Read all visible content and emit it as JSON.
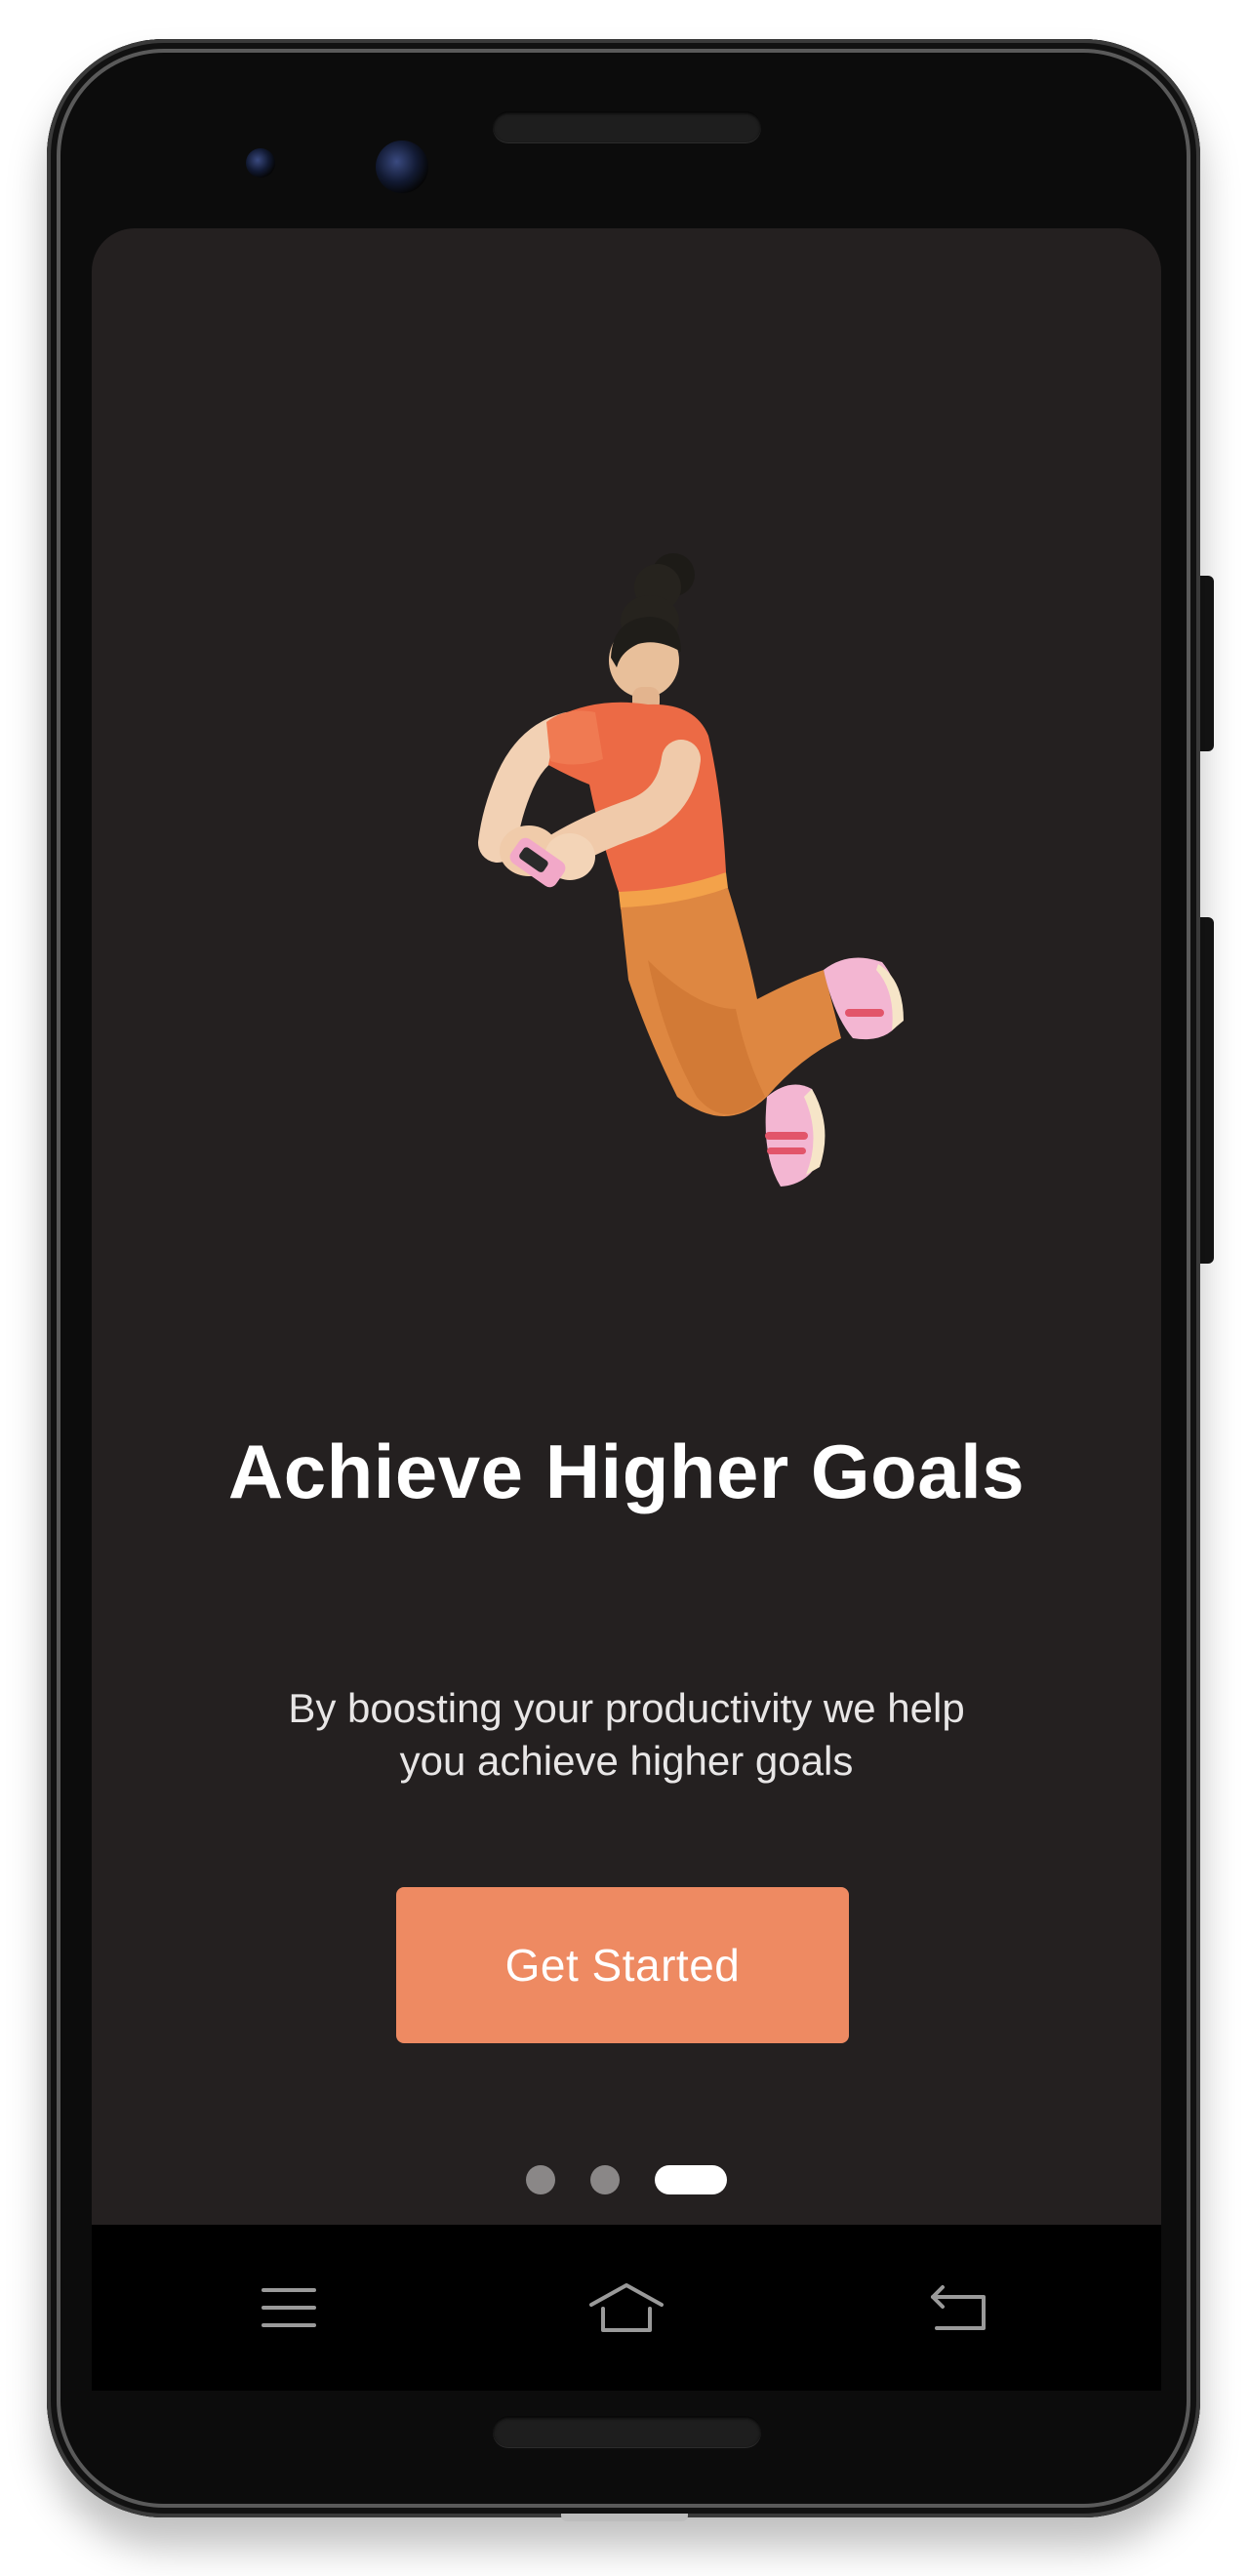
{
  "onboarding": {
    "illustration": "person-floating-with-phone",
    "title": "Achieve Higher Goals",
    "subtitle": "By boosting your productivity we help you achieve higher goals",
    "cta_label": "Get Started",
    "pagination": {
      "total": 3,
      "active_index": 2
    }
  },
  "navigation_bar": {
    "menu_icon": "menu-icon",
    "home_icon": "home-icon",
    "back_icon": "back-icon"
  },
  "colors": {
    "screen_background": "#242020",
    "accent": "#ee8a62",
    "title_text": "#ffffff",
    "dot_inactive": "#8a8787",
    "dot_active": "#ffffff",
    "shirt": "#ec6a45",
    "pants": "#de8741",
    "shoes": "#f3b6d2"
  }
}
